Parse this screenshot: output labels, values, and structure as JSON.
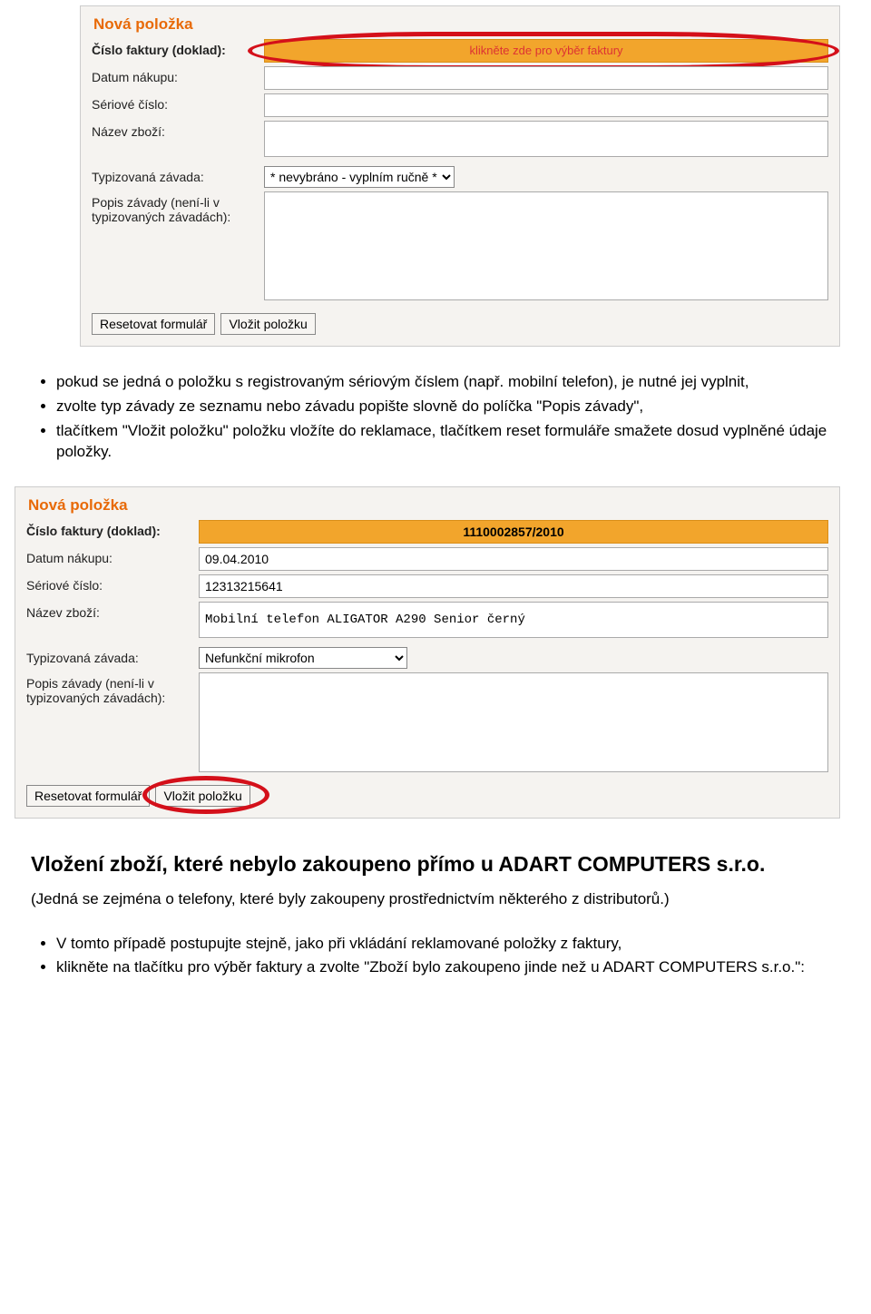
{
  "form1": {
    "title": "Nová položka",
    "labels": {
      "invoice": "Číslo faktury (doklad):",
      "date": "Datum nákupu:",
      "serial": "Sériové číslo:",
      "name": "Název zboží:",
      "type": "Typizovaná závada:",
      "desc": "Popis závady (není-li v typizovaných závadách):"
    },
    "invoice_placeholder": "klikněte zde pro výběr faktury",
    "type_option": "* nevybráno - vyplním ručně *",
    "btn_reset": "Resetovat formulář",
    "btn_submit": "Vložit položku",
    "values": {
      "date": "",
      "serial": "",
      "name": ""
    }
  },
  "bullets1": {
    "i1a": "pokud se jedná o položku s registrovaným sériovým číslem (např. mobilní telefon), je nutné jej vyplnit,",
    "i2": "zvolte typ závady ze seznamu nebo závadu popište slovně do políčka \"Popis závady\",",
    "i3": "tlačítkem \"Vložit položku\" položku vložíte do reklamace, tlačítkem reset formuláře smažete dosud vyplněné údaje položky."
  },
  "form2": {
    "title": "Nová položka",
    "labels": {
      "invoice": "Číslo faktury (doklad):",
      "date": "Datum nákupu:",
      "serial": "Sériové číslo:",
      "name": "Název zboží:",
      "type": "Typizovaná závada:",
      "desc": "Popis závady (není-li v typizovaných závadách):"
    },
    "invoice_value": "1110002857/2010",
    "values": {
      "date": "09.04.2010",
      "serial": "12313215641",
      "name": "Mobilní telefon ALIGATOR A290 Senior černý"
    },
    "type_option": "Nefunkční mikrofon",
    "btn_reset": "Resetovat formulář",
    "btn_submit": "Vložit položku"
  },
  "heading2": "Vložení zboží, které nebylo zakoupeno přímo u ADART COMPUTERS s.r.o.",
  "sub2": "(Jedná se zejména o telefony, které byly zakoupeny prostřednictvím některého z distributorů.)",
  "bullets2": {
    "i1": "V tomto případě postupujte stejně, jako při vkládání reklamované položky z faktury,",
    "i2": "klikněte na tlačítku pro výběr faktury a zvolte \"Zboží bylo zakoupeno jinde než u ADART COMPUTERS s.r.o.\":"
  }
}
